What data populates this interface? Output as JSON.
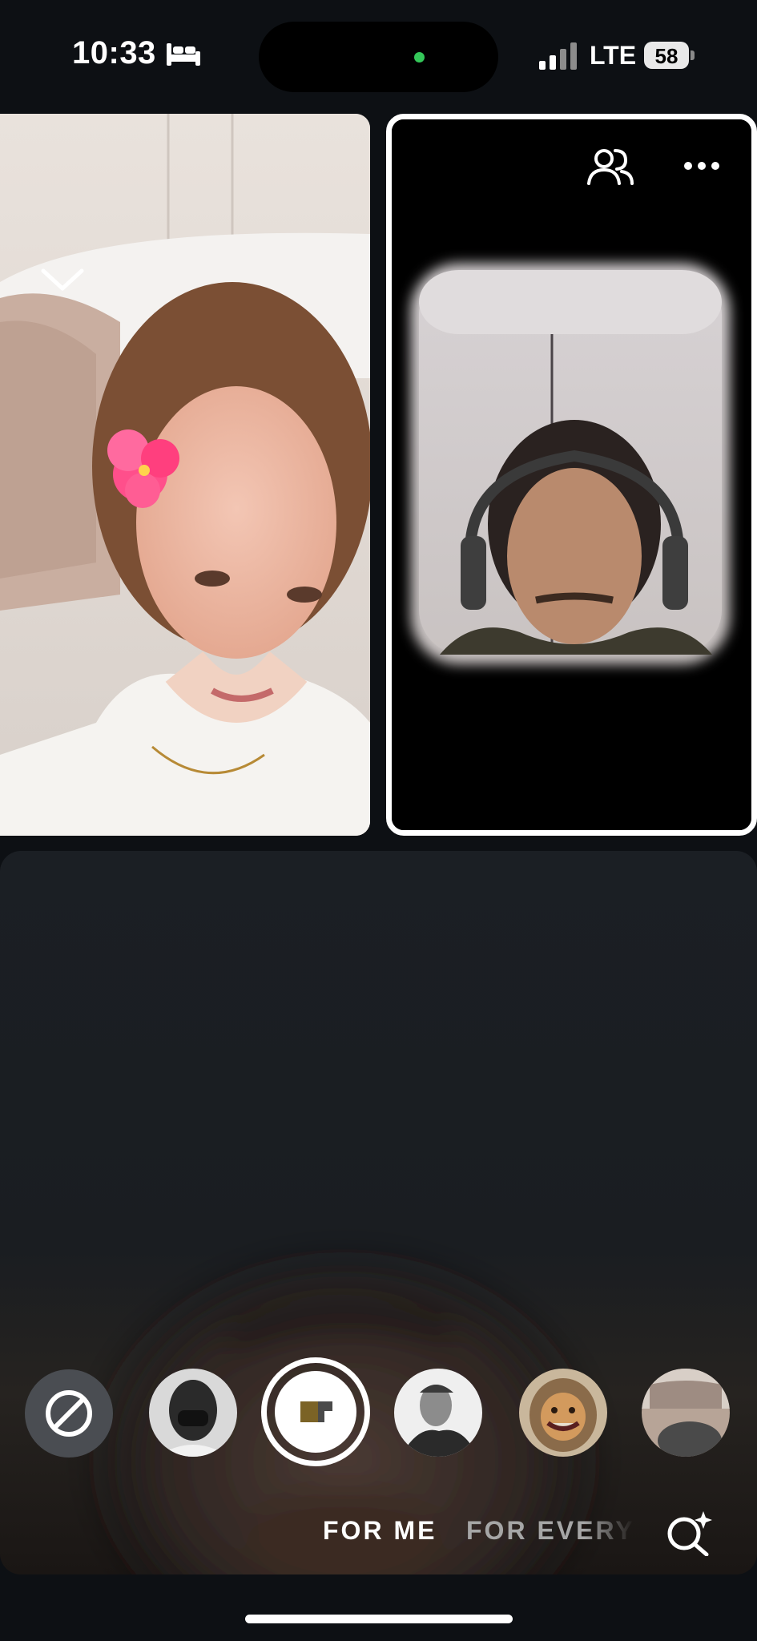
{
  "status_bar": {
    "time": "10:33",
    "network": "LTE",
    "battery": "58",
    "icons": [
      "bed-icon",
      "signal-icon",
      "battery-icon"
    ],
    "privacy_dot_color": "#34c759"
  },
  "call": {
    "controls": {
      "minimize_icon": "chevron-down-icon",
      "participants_icon": "people-icon",
      "more_icon": "more-icon"
    },
    "tiles": [
      {
        "id": "participant-left",
        "kind": "video"
      },
      {
        "id": "participant-right",
        "kind": "video",
        "highlighted": true
      },
      {
        "id": "self-view",
        "kind": "video"
      }
    ]
  },
  "effects_tray": {
    "items": [
      {
        "id": "no-effect",
        "icon": "no-effect-icon"
      },
      {
        "id": "effect-1",
        "kind": "thumbnail"
      },
      {
        "id": "effect-2",
        "kind": "selected",
        "icon": "film-icon"
      },
      {
        "id": "effect-3",
        "kind": "thumbnail"
      },
      {
        "id": "effect-4",
        "kind": "thumbnail"
      },
      {
        "id": "effect-5",
        "kind": "thumbnail"
      }
    ],
    "tabs": [
      {
        "label": "FOR ME",
        "active": true
      },
      {
        "label": "FOR EVERYONE",
        "active": false
      }
    ],
    "search_icon": "search-sparkle-icon"
  }
}
